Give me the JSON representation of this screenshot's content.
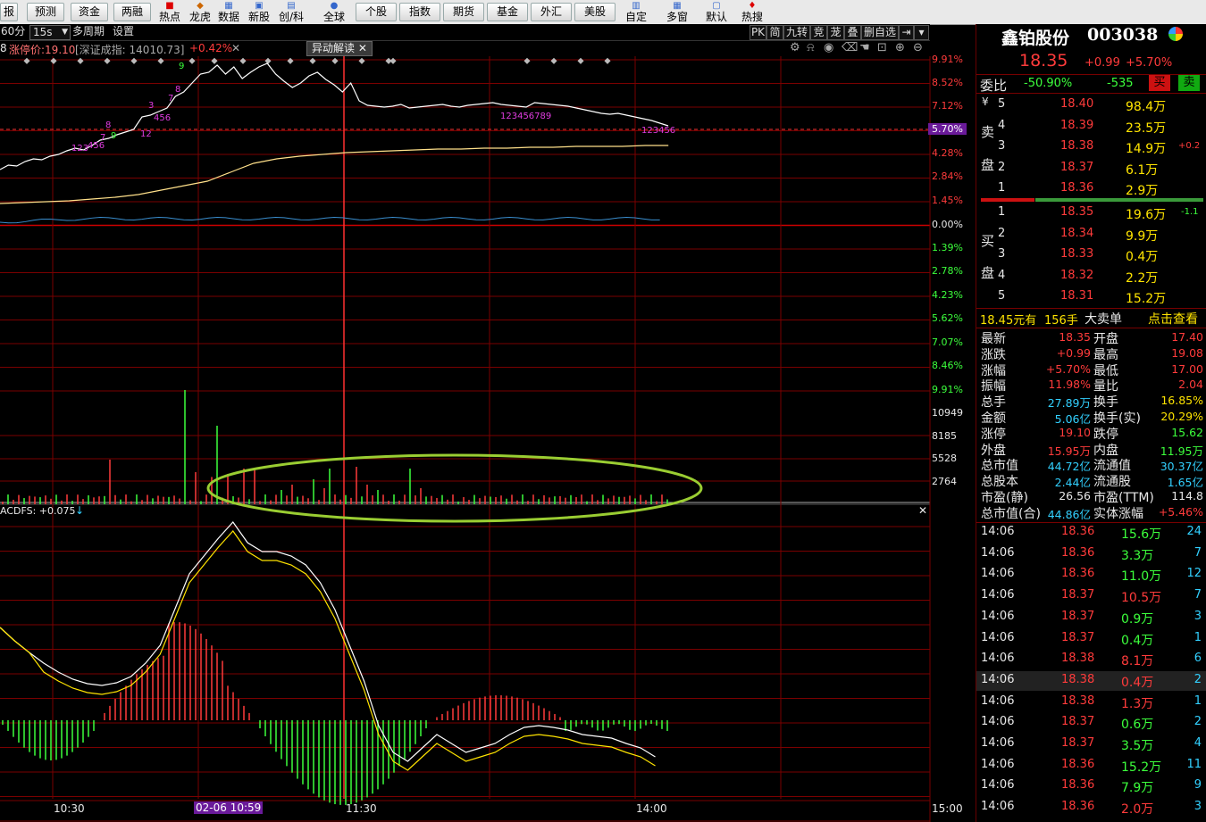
{
  "toolbar": {
    "buttons": [
      "报",
      "预测",
      "资金",
      "两融"
    ],
    "icons": [
      {
        "label": "热点",
        "glyph": "hot-icon"
      },
      {
        "label": "龙虎",
        "glyph": "dragon-icon"
      },
      {
        "label": "数据",
        "glyph": "data-icon"
      },
      {
        "label": "新股",
        "glyph": "new-stock-icon"
      },
      {
        "label": "创/科",
        "glyph": "chart-icon"
      },
      {
        "label": "全球",
        "glyph": "globe-icon"
      }
    ],
    "buttons2": [
      "个股",
      "指数",
      "期货",
      "基金",
      "外汇",
      "美股"
    ],
    "icons2": [
      {
        "label": "自定",
        "glyph": "custom-icon"
      },
      {
        "label": "多窗",
        "glyph": "windows-icon"
      },
      {
        "label": "默认",
        "glyph": "default-icon"
      },
      {
        "label": "热搜",
        "glyph": "hot-search-icon"
      }
    ]
  },
  "chartbar": {
    "period": "60分",
    "interval": "15s",
    "multi": "多周期",
    "settings": "设置",
    "right_buttons": [
      "PK",
      "简",
      "九转",
      "竞",
      "茏",
      "叠",
      "删自选"
    ]
  },
  "infoline": {
    "prefix": "8",
    "limit_label": "涨停价:19.10",
    "index_label": "[深证成指: 14010.73]",
    "index_change": "+0.42%",
    "popup": "异动解读"
  },
  "price_axis": {
    "up": [
      "9.91%",
      "8.52%",
      "7.12%",
      "5.70%",
      "4.28%",
      "2.84%",
      "1.45%",
      "0.00%"
    ],
    "down": [
      "1.39%",
      "2.78%",
      "4.23%",
      "5.62%",
      "7.07%",
      "8.46%",
      "9.91%"
    ]
  },
  "volume_axis": [
    "10949",
    "8185",
    "5528",
    "2764"
  ],
  "indicator_label": "ACDFS: +0.075",
  "time_axis": {
    "t1": "10:30",
    "t2": "02-06 10:59",
    "t3": "11:30",
    "t4": "14:00",
    "t5": "15:00"
  },
  "stock": {
    "name": "鑫铂股份",
    "code": "003038",
    "price": "18.35",
    "change": "+0.99",
    "pct": "+5.70%",
    "weibi_label": "委比",
    "weibi": "-50.90%",
    "weicha": "-535",
    "sell_btn": "买",
    "buy_btn": "卖"
  },
  "asks": [
    {
      "lvl": "5",
      "price": "18.40",
      "vol": "98.4万",
      "note": ""
    },
    {
      "lvl": "4",
      "price": "18.39",
      "vol": "23.5万",
      "note": ""
    },
    {
      "lvl": "3",
      "price": "18.38",
      "vol": "14.9万",
      "note": "+0.2"
    },
    {
      "lvl": "2",
      "price": "18.37",
      "vol": "6.1万",
      "note": ""
    },
    {
      "lvl": "1",
      "price": "18.36",
      "vol": "2.9万",
      "note": ""
    }
  ],
  "ask_side": [
    "¥",
    "卖",
    "盘"
  ],
  "bids": [
    {
      "lvl": "1",
      "price": "18.35",
      "vol": "19.6万",
      "note": "-1.1"
    },
    {
      "lvl": "2",
      "price": "18.34",
      "vol": "9.9万",
      "note": ""
    },
    {
      "lvl": "3",
      "price": "18.33",
      "vol": "0.4万",
      "note": ""
    },
    {
      "lvl": "4",
      "price": "18.32",
      "vol": "2.2万",
      "note": ""
    },
    {
      "lvl": "5",
      "price": "18.31",
      "vol": "15.2万",
      "note": ""
    }
  ],
  "bid_side": [
    "买",
    "盘"
  ],
  "bigorder": {
    "price": "18.45元有",
    "qty": "156手",
    "label": "大卖单",
    "link": "点击查看"
  },
  "stats": [
    [
      "最新",
      "18.35",
      "red",
      "开盘",
      "17.40",
      "red"
    ],
    [
      "涨跌",
      "+0.99",
      "red",
      "最高",
      "19.08",
      "red"
    ],
    [
      "涨幅",
      "+5.70%",
      "red",
      "最低",
      "17.00",
      "red"
    ],
    [
      "振幅",
      "11.98%",
      "red",
      "量比",
      "2.04",
      "red"
    ],
    [
      "总手",
      "27.89万",
      "cyan",
      "换手",
      "16.85%",
      "yellow"
    ],
    [
      "金额",
      "5.06亿",
      "cyan",
      "换手(实)",
      "20.29%",
      "yellow"
    ],
    [
      "涨停",
      "19.10",
      "red",
      "跌停",
      "15.62",
      "green"
    ],
    [
      "外盘",
      "15.95万",
      "red",
      "内盘",
      "11.95万",
      "green"
    ],
    [
      "总市值",
      "44.72亿",
      "cyan",
      "流通值",
      "30.37亿",
      "cyan"
    ],
    [
      "总股本",
      "2.44亿",
      "cyan",
      "流通股",
      "1.65亿",
      "cyan"
    ],
    [
      "市盈(静)",
      "26.56",
      "white",
      "市盈(TTM)",
      "114.8",
      "white"
    ],
    [
      "总市值(合)",
      "44.86亿",
      "cyan",
      "实体涨幅",
      "+5.46%",
      "red"
    ]
  ],
  "ticks": [
    {
      "time": "14:06",
      "price": "18.36",
      "vol": "15.6万",
      "vc": "green",
      "n": "24"
    },
    {
      "time": "14:06",
      "price": "18.36",
      "vol": "3.3万",
      "vc": "green",
      "n": "7"
    },
    {
      "time": "14:06",
      "price": "18.36",
      "vol": "11.0万",
      "vc": "green",
      "n": "12"
    },
    {
      "time": "14:06",
      "price": "18.37",
      "vol": "10.5万",
      "vc": "red",
      "n": "7"
    },
    {
      "time": "14:06",
      "price": "18.37",
      "vol": "0.9万",
      "vc": "green",
      "n": "3"
    },
    {
      "time": "14:06",
      "price": "18.37",
      "vol": "0.4万",
      "vc": "green",
      "n": "1"
    },
    {
      "time": "14:06",
      "price": "18.38",
      "vol": "8.1万",
      "vc": "red",
      "n": "6"
    },
    {
      "time": "14:06",
      "price": "18.38",
      "vol": "0.4万",
      "vc": "red",
      "n": "2"
    },
    {
      "time": "14:06",
      "price": "18.38",
      "vol": "1.3万",
      "vc": "red",
      "n": "1"
    },
    {
      "time": "14:06",
      "price": "18.37",
      "vol": "0.6万",
      "vc": "green",
      "n": "2"
    },
    {
      "time": "14:06",
      "price": "18.37",
      "vol": "3.5万",
      "vc": "green",
      "n": "4"
    },
    {
      "time": "14:06",
      "price": "18.36",
      "vol": "15.2万",
      "vc": "green",
      "n": "11"
    },
    {
      "time": "14:06",
      "price": "18.36",
      "vol": "7.9万",
      "vc": "green",
      "n": "9"
    },
    {
      "time": "14:06",
      "price": "18.36",
      "vol": "2.0万",
      "vc": "red",
      "n": "3"
    }
  ],
  "colors": {
    "bg": "#000000",
    "grid": "#7a0000",
    "up": "#ff3b3b",
    "down": "#3cff3c",
    "price_line": "#ffffff",
    "avg_line": "#ffe08a",
    "ellipse": "#9acd32"
  },
  "markers": {
    "m1": "123",
    "m2": "456",
    "m3": "7",
    "m4": "8",
    "m5": "9",
    "m6": "12",
    "m7": "3",
    "m8": "456",
    "m9": "7",
    "m10": "8",
    "m11": "9",
    "m12": "123456789",
    "m13": "123456"
  }
}
